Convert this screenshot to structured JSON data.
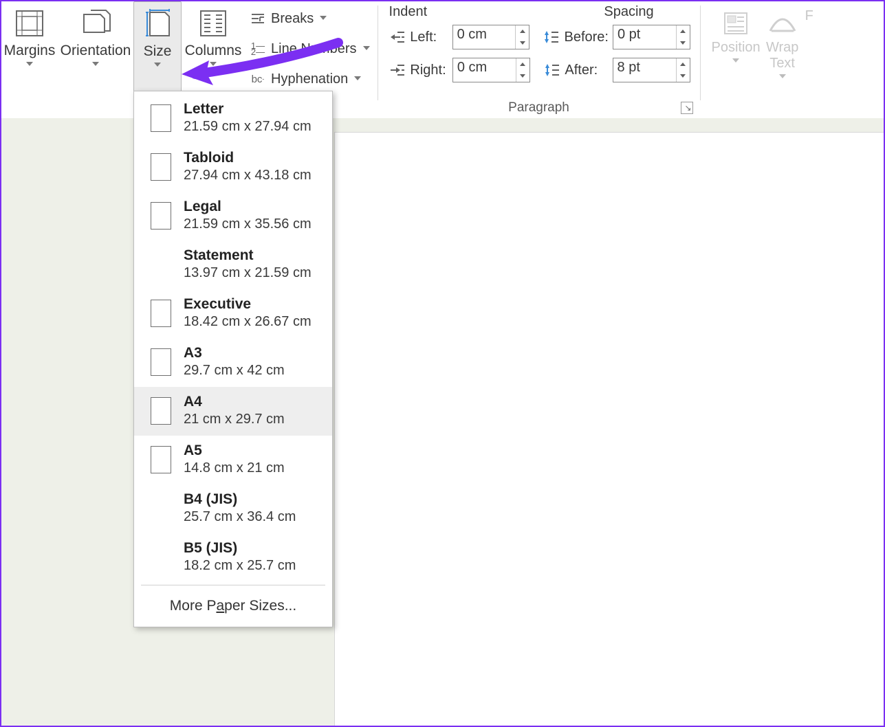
{
  "ribbon": {
    "page_setup": {
      "margins": "Margins",
      "orientation": "Orientation",
      "size": "Size",
      "columns": "Columns",
      "breaks": "Breaks",
      "line_numbers": "Line Numbers",
      "hyphenation": "Hyphenation"
    },
    "paragraph": {
      "indent_header": "Indent",
      "spacing_header": "Spacing",
      "left_label": "Left:",
      "right_label": "Right:",
      "before_label": "Before:",
      "after_label": "After:",
      "left_value": "0 cm",
      "right_value": "0 cm",
      "before_value": "0 pt",
      "after_value": "8 pt",
      "group_label": "Paragraph"
    },
    "arrange": {
      "position": "Position",
      "wrap_text": "Wrap\nText"
    }
  },
  "size_menu": {
    "items": [
      {
        "name": "Letter",
        "dims": "21.59 cm x 27.94 cm",
        "icon": true
      },
      {
        "name": "Tabloid",
        "dims": "27.94 cm x 43.18 cm",
        "icon": true
      },
      {
        "name": "Legal",
        "dims": "21.59 cm x 35.56 cm",
        "icon": true
      },
      {
        "name": "Statement",
        "dims": "13.97 cm x 21.59 cm",
        "icon": false
      },
      {
        "name": "Executive",
        "dims": "18.42 cm x 26.67 cm",
        "icon": true
      },
      {
        "name": "A3",
        "dims": "29.7 cm x 42 cm",
        "icon": true
      },
      {
        "name": "A4",
        "dims": "21 cm x 29.7 cm",
        "icon": true,
        "hover": true
      },
      {
        "name": "A5",
        "dims": "14.8 cm x 21 cm",
        "icon": true
      },
      {
        "name": "B4 (JIS)",
        "dims": "25.7 cm x 36.4 cm",
        "icon": false
      },
      {
        "name": "B5 (JIS)",
        "dims": "18.2 cm x 25.7 cm",
        "icon": false
      }
    ],
    "more": "More Paper Sizes..."
  },
  "annotation": {
    "arrow_color": "#7b2ff2"
  }
}
